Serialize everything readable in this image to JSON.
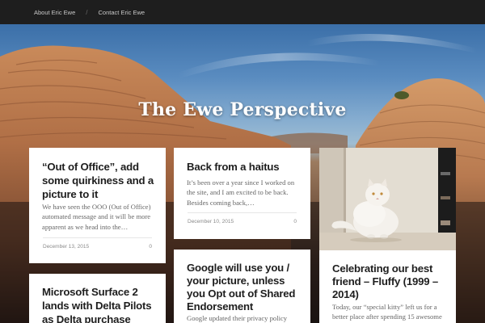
{
  "nav": {
    "items": [
      {
        "label": "About Eric Ewe"
      },
      {
        "label": "Contact Eric Ewe"
      }
    ],
    "separator": "/"
  },
  "hero": {
    "site_title": "The Ewe Perspective"
  },
  "posts": [
    {
      "title": "“Out of Office”, add some quirkiness and a picture to it",
      "excerpt": "We have seen the OOO (Out of Office) automated message and it will be more apparent as we head into the…",
      "date": "December 13, 2015",
      "comments": "0"
    },
    {
      "title": "Back from a haitus",
      "excerpt": "It’s been over a year since I worked on the site, and I am excited to be back. Besides coming back,…",
      "date": "December 10, 2015",
      "comments": "0"
    },
    {
      "image": "white-persian-cat-photo"
    },
    {
      "title": "Microsoft Surface 2 lands with Delta Pilots as Delta purchase"
    },
    {
      "title": "Google will use you / your picture, unless you Opt out of Shared Endorsement",
      "excerpt": "Google updated their privacy policy"
    },
    {
      "title": "Celebrating our best friend – Fluffy (1999 – 2014)",
      "excerpt": "Today, our “special kitty” left us for a better place after spending 15 awesome"
    }
  ],
  "colors": {
    "topbar": "#1e1e1e",
    "card_bg": "#ffffff",
    "title_text": "#1e1e1e",
    "excerpt_text": "#666666",
    "meta_text": "#8a8a8a"
  }
}
